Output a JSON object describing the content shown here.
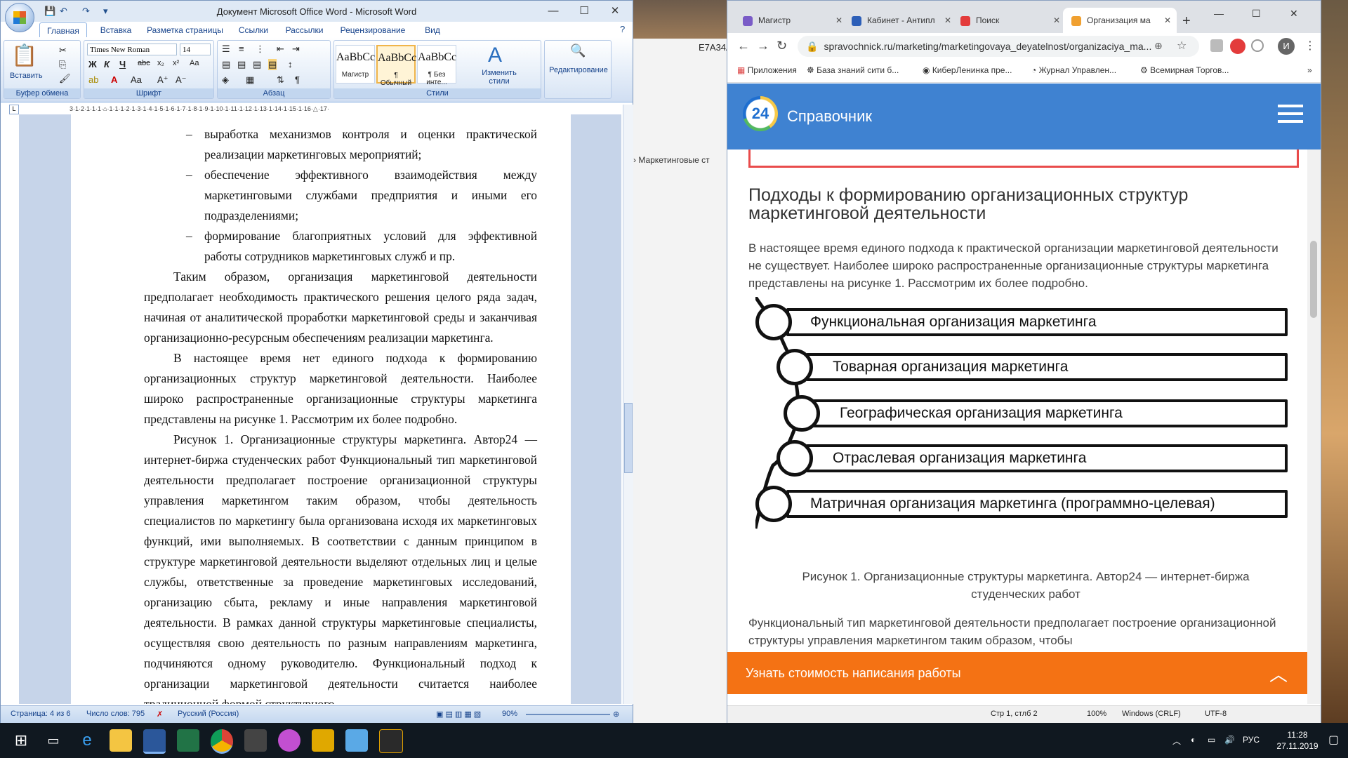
{
  "word": {
    "title": "Документ Microsoft Office Word - Microsoft Word",
    "tabs": [
      "Главная",
      "Вставка",
      "Разметка страницы",
      "Ссылки",
      "Рассылки",
      "Рецензирование",
      "Вид"
    ],
    "ribbon": {
      "paste_label": "Вставить",
      "clipboard_label": "Буфер обмена",
      "font_name": "Times New Roman",
      "font_size": "14",
      "font_label": "Шрифт",
      "paragraph_label": "Абзац",
      "styles": [
        {
          "sample": "AaBbCc",
          "name": "Магистр"
        },
        {
          "sample": "AaBbCc",
          "name": "¶ Обычный"
        },
        {
          "sample": "AaBbCc",
          "name": "¶ Без инте..."
        }
      ],
      "change_styles_label": "Изменить стили",
      "styles_label": "Стили",
      "editing_label": "Редактирование"
    },
    "doc": {
      "bullets": [
        "выработка механизмов контроля и оценки практической реализации маркетинговых мероприятий;",
        "обеспечение эффективного взаимодействия между маркетинговыми службами предприятия и иными его подразделениями;",
        "формирование благоприятных условий для эффективной работы сотрудников маркетинговых служб и пр."
      ],
      "paragraphs": [
        "Таким образом, организация маркетинговой деятельности предполагает необходимость практического решения целого ряда задач, начиная от аналитической проработки маркетинговой среды и заканчивая организационно-ресурсным обеспечениям реализации маркетинга.",
        "В настоящее время нет единого подхода к формированию организационных структур маркетинговой деятельности. Наиболее широко распространенные организационные структуры маркетинга представлены на рисунке 1. Рассмотрим их более подробно."
      ],
      "last_paragraph": "Рисунок 1. Организационные структуры маркетинга. Автор24 — интернет-биржа студенческих работ Функциональный тип маркетинговой деятельности предполагает построение организационной структуры управления маркетингом таким образом, чтобы деятельность специалистов по маркетингу была организована исходя их маркетинговых функций, ими выполняемых. В соответствии с данным принципом в структуре маркетинговой деятельности выделяют отдельных лиц и целые службы, ответственные за проведение маркетинговых исследований, организацию сбыта, рекламу и иные направления маркетинговой деятельности. В рамках данной структуры маркетинговые специалисты, осуществляя свою деятельность по разным направлениям маркетинга, подчиняются одному руководителю. Функциональный подход к организации маркетинговой деятельности считается наиболее традиционной формой структурного"
    },
    "status": {
      "page": "Страница: 4 из 6",
      "words": "Число слов: 795",
      "lang": "Русский (Россия)",
      "zoom": "90%"
    }
  },
  "desktop": {
    "code": "E7A34A",
    "breadcrumb": "›  Маркетинговые ст"
  },
  "chrome": {
    "tabs": [
      {
        "label": "Магистр",
        "color": "#7a5cc7"
      },
      {
        "label": "Кабинет - Антипл",
        "color": "#2d5fb8"
      },
      {
        "label": "Поиск",
        "color": "#e33b3b"
      },
      {
        "label": "Организация ма",
        "color": "#f0a030"
      }
    ],
    "url": "spravochnick.ru/marketing/marketingovaya_deyatelnost/organizaciya_ma...",
    "bookmarks": [
      "Приложения",
      "База знаний сити б...",
      "КиберЛенинка пре...",
      "Журнал Управлен...",
      "Всемирная Торгов..."
    ],
    "avatar": "И",
    "site": {
      "name": "Справочник",
      "logo": "24",
      "heading": "Подходы к формированию организационных структур маркетинговой деятельности",
      "intro": "В настоящее время единого подхода к практической организации маркетинговой деятельности не существует. Наиболее широко распространенные организационные структуры маркетинга представлены на рисунке 1. Рассмотрим их более подробно.",
      "diagram_items": [
        "Функциональная организация маркетинга",
        "Товарная организация маркетинга",
        "Географическая организация маркетинга",
        "Отраслевая организация маркетинга",
        "Матричная организация маркетинга (программно-целевая)"
      ],
      "caption": "Рисунок 1. Организационные структуры маркетинга. Автор24 — интернет-биржа студенческих работ",
      "after_text": "Функциональный тип маркетинговой деятельности предполагает построение организационной структуры управления маркетингом таким образом, чтобы",
      "cta": "Узнать стоимость написания работы"
    },
    "status": {
      "pos": "Стр 1, стлб 2",
      "zoom": "100%",
      "eol": "Windows (CRLF)",
      "enc": "UTF-8"
    }
  },
  "taskbar": {
    "lang": "РУС",
    "time": "11:28",
    "date": "27.11.2019",
    "icons": [
      "start-icon",
      "task-view-icon",
      "edge-icon",
      "file-explorer-icon",
      "word-icon",
      "excel-icon",
      "chrome-icon",
      "calculator-icon",
      "maps-icon",
      "app-icon",
      "notes-icon",
      "game-icon"
    ]
  }
}
